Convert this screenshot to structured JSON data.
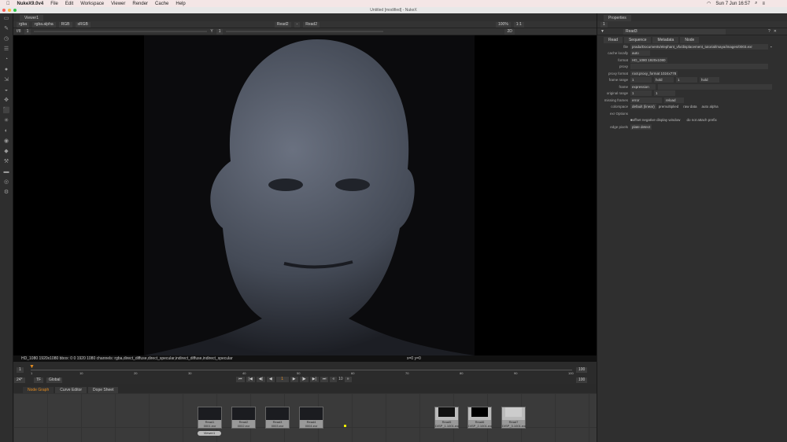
{
  "menubar": {
    "app": "NukeX9.0v4",
    "items": [
      "File",
      "Edit",
      "Workspace",
      "Viewer",
      "Render",
      "Cache",
      "Help"
    ],
    "clock": "Sun 7 Jun  16:57"
  },
  "window": {
    "title": "Untitled [modified] - NukeX"
  },
  "viewer": {
    "tab": "Viewer1",
    "channels": "rgba",
    "alpha": "rgba.alpha",
    "display": "RGB",
    "lut": "sRGB",
    "input_a": "Read2",
    "input_mid": "-",
    "input_b": "Read2",
    "zoom": "100%",
    "ratio": "1:1",
    "fstop_label": "f/8",
    "gain": "1",
    "gamma_label": "Y",
    "gamma": "1",
    "mode": "2D",
    "info": "HD_1080 1920x1080  bbox: 0 0 1920 1080 channels: rgba,direct_diffuse,direct_specular,indirect_diffuse,indirect_specular",
    "coords": "x=0 y=0"
  },
  "timeline": {
    "start": "1",
    "ticks": [
      "1",
      "10",
      "20",
      "30",
      "40",
      "50",
      "60",
      "70",
      "80",
      "90",
      "100"
    ],
    "end": "100",
    "end2": "100",
    "fps": "24*",
    "tf": "TF",
    "scope": "Global",
    "current_frame": "1",
    "step": "10"
  },
  "nodetabs": [
    "Node Graph",
    "Curve Editor",
    "Dope Sheet"
  ],
  "nodes": [
    {
      "name": "Read1",
      "file": "0001.exr"
    },
    {
      "name": "Read2",
      "file": "0002.exr"
    },
    {
      "name": "Read3",
      "file": "0003.exr"
    },
    {
      "name": "Read4",
      "file": "0004.exr"
    },
    {
      "name": "Read5",
      "file": "DISP_1.1001.exr"
    },
    {
      "name": "Read6",
      "file": "DISP_2.1001.exr"
    },
    {
      "name": "Read7",
      "file": "DISP_3.1001.exr"
    }
  ],
  "viewer_node": "Viewer1",
  "properties": {
    "tab": "Properties",
    "count": "1",
    "node_name": "Read3",
    "tabs": [
      "Read",
      "Sequence",
      "Metadata",
      "Node"
    ],
    "file": "prada/Documents/elephant_vfx/displacement_tutorial/maya/images/0003.exr",
    "cache_locally": "auto",
    "format": "HD_1080 1920x1080",
    "proxy": "",
    "proxy_format": "root.proxy_format 1024x778",
    "frame_range": [
      "1",
      "hold",
      "1",
      "hold"
    ],
    "frame": "expression",
    "original_range": [
      "1",
      "1"
    ],
    "missing_frames": "error",
    "reload": "reload",
    "colorspace": "default (linear)",
    "premultiplied": "premultiplied",
    "raw_data": "raw data",
    "auto_alpha": "auto alpha",
    "exr_options": "exr Options",
    "offset": "offset negative display window",
    "prefix": "do not attach prefix",
    "edge_pixels": "plate detect",
    "labels": {
      "file": "file",
      "cache": "cache locally",
      "format": "format",
      "proxy": "proxy",
      "proxy_format": "proxy format",
      "frame_range": "frame range",
      "frame": "frame",
      "original_range": "original range",
      "missing": "missing frames",
      "colorspace": "colorspace",
      "edge": "edge pixels"
    }
  }
}
